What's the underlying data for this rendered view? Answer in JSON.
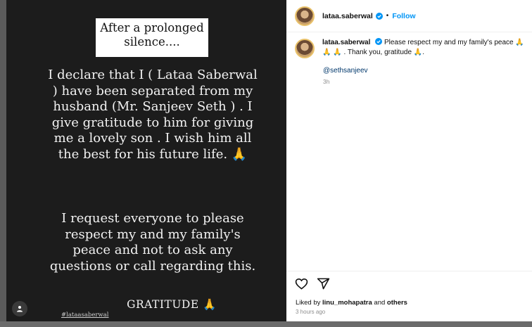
{
  "post": {
    "username": "lataa.saberwal",
    "follow_label": "Follow",
    "separator": "•",
    "caption_text": "Please respect my and my family's peace 🙏 🙏 🙏 . Thank you, gratitude 🙏.",
    "mention": "@sethsanjeev",
    "caption_time": "3h",
    "liked_prefix": "Liked by",
    "liked_user": "linu_mohapatra",
    "liked_and": "and",
    "liked_others": "others",
    "time_ago": "3 hours ago"
  },
  "story": {
    "box_text": "After a prolonged silence....",
    "paragraph1": "I declare that I ( Lataa Saberwal ) have been separated from my husband (Mr. Sanjeev Seth ) . I give gratitude to him for giving me a lovely son .  I wish him all the best for his future life. 🙏",
    "paragraph2": "I request everyone to please  respect my and my family's peace and not to ask any questions or call regarding this.",
    "signoff": "GRATITUDE 🙏",
    "hashtag": "#lataasaberwal"
  },
  "icons": {
    "verified": "verified-badge-icon",
    "like": "heart-icon",
    "share": "send-icon",
    "tag": "user-tag-icon"
  },
  "colors": {
    "follow": "#0095f6",
    "verified": "#0095f6",
    "mention": "#00376b"
  }
}
